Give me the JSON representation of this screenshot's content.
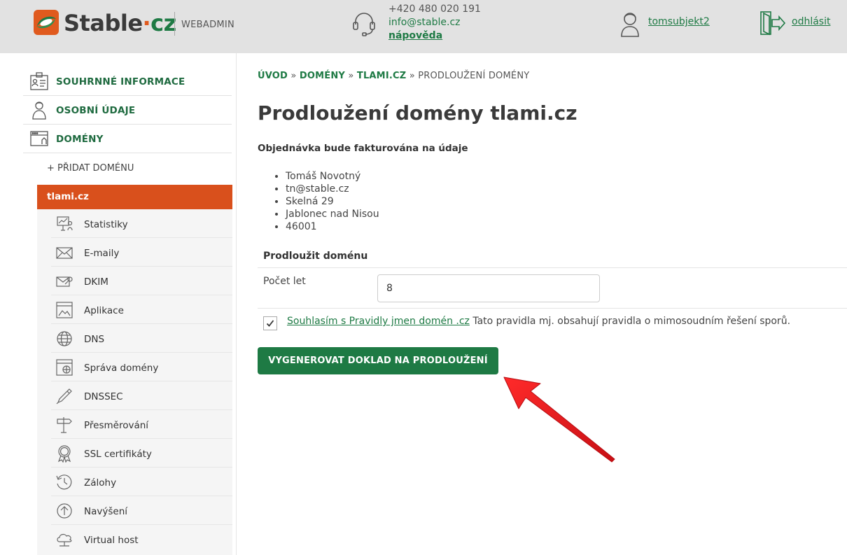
{
  "header": {
    "logo_main": "Stable",
    "logo_dot": "·",
    "logo_cz": "cz",
    "webadmin": "WEBADMIN",
    "phone": "+420 480 020 191",
    "email": "info@stable.cz",
    "help": "nápověda",
    "username": "tomsubjekt2",
    "logout": "odhlásit"
  },
  "sidebar": {
    "top_items": [
      {
        "label": "SOUHRNNÉ INFORMACE",
        "icon": "id-card-icon"
      },
      {
        "label": "OSOBNÍ ÚDAJE",
        "icon": "person-icon"
      },
      {
        "label": "DOMÉNY",
        "icon": "browser-window-icon"
      }
    ],
    "add_domain": "+ PŘIDAT DOMÉNU",
    "active_domain": "tlami.cz",
    "sub_items": [
      {
        "label": "Statistiky",
        "icon": "presentation-chart-icon"
      },
      {
        "label": "E-maily",
        "icon": "envelope-icon"
      },
      {
        "label": "DKIM",
        "icon": "mail-key-icon"
      },
      {
        "label": "Aplikace",
        "icon": "app-window-icon"
      },
      {
        "label": "DNS",
        "icon": "globe-icon"
      },
      {
        "label": "Správa domény",
        "icon": "domain-settings-icon"
      },
      {
        "label": "DNSSEC",
        "icon": "pen-key-icon"
      },
      {
        "label": "Přesměrování",
        "icon": "signpost-icon"
      },
      {
        "label": "SSL certifikáty",
        "icon": "ssl-badge-icon"
      },
      {
        "label": "Zálohy",
        "icon": "backup-clock-icon"
      },
      {
        "label": "Navýšení",
        "icon": "arrow-up-circle-icon"
      },
      {
        "label": "Virtual host",
        "icon": "cloud-server-icon"
      }
    ]
  },
  "breadcrumb": {
    "home": "ÚVOD",
    "domains": "DOMÉNY",
    "domain": "TLAMI.CZ",
    "current": "PRODLOUŽENÍ DOMÉNY",
    "separator": "»"
  },
  "main": {
    "title": "Prodloužení domény tlami.cz",
    "billing_note": "Objednávka bude fakturována na údaje",
    "billing": [
      "Tomáš Novotný",
      "tn@stable.cz",
      "Skelná 29",
      "Jablonec nad Nisou",
      "46001"
    ],
    "section_title": "Prodloužit doménu",
    "years_label": "Počet let",
    "years_value": "8",
    "agree_link": "Souhlasím s Pravidly jmen domén .cz",
    "agree_text": " Tato pravidla mj. obsahují pravidla o mimosoudním řešení sporů.",
    "agree_checked": true,
    "submit": "VYGENEROVAT DOKLAD NA PRODLOUŽENÍ"
  },
  "colors": {
    "brand_green": "#1e7a44",
    "accent_orange": "#d9501c",
    "header_bg": "#e2e2e2",
    "annotation_red": "#e8141b"
  }
}
